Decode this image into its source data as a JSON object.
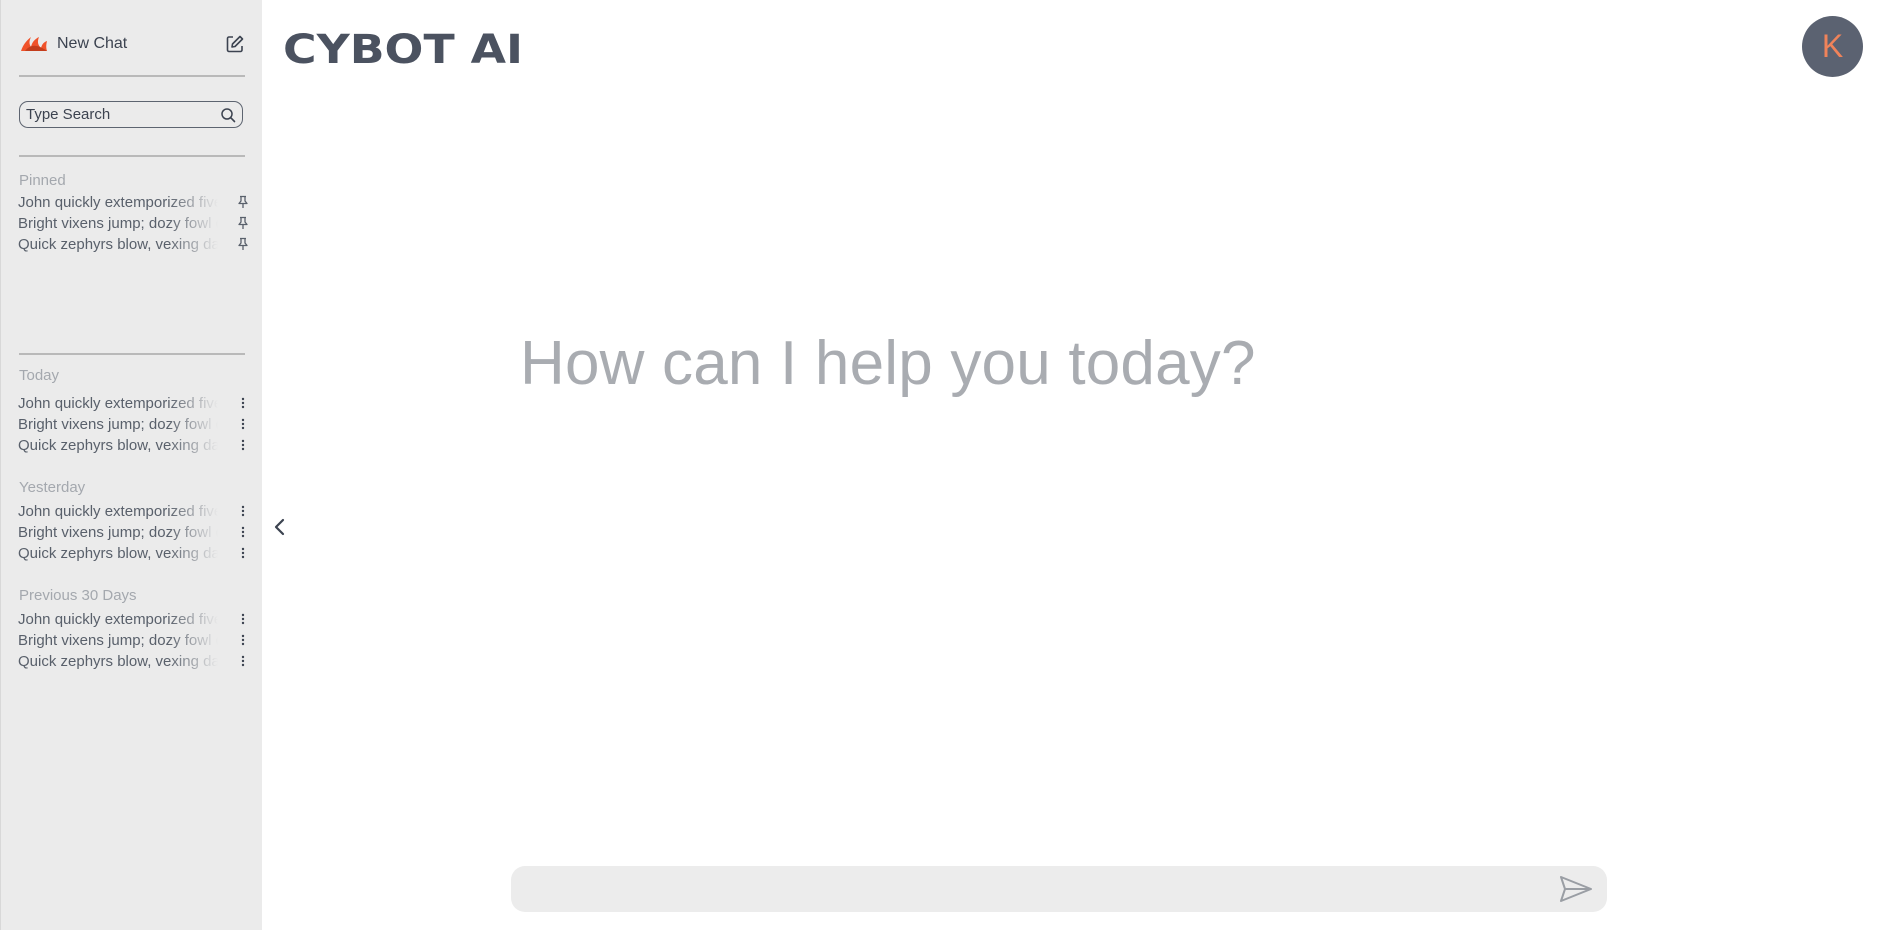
{
  "sidebar": {
    "new_chat_label": "New Chat",
    "search": {
      "placeholder": "Type Search",
      "value": ""
    },
    "pinned": {
      "label": "Pinned",
      "items": [
        "John quickly extemporized five tow bags",
        "Bright vixens jump; dozy fowl quack",
        "Quick zephyrs blow, vexing daft Jim"
      ]
    },
    "groups": [
      {
        "label": "Today",
        "items": [
          "John quickly extemporized five tow bags",
          "Bright vixens jump; dozy fowl quack",
          "Quick zephyrs blow, vexing daft Jim"
        ]
      },
      {
        "label": "Yesterday",
        "items": [
          "John quickly extemporized five tow bags",
          "Bright vixens jump; dozy fowl quack",
          "Quick zephyrs blow, vexing daft Jim"
        ]
      },
      {
        "label": "Previous 30 Days",
        "items": [
          "John quickly extemporized five tow bags",
          "Bright vixens jump; dozy fowl quack",
          "Quick zephyrs blow, vexing daft Jim"
        ]
      }
    ]
  },
  "header": {
    "logo_text": "CYBOT AI"
  },
  "user": {
    "avatar_initial": "K"
  },
  "main": {
    "headline": "How can I help you today?"
  },
  "composer": {
    "placeholder": "",
    "value": ""
  },
  "icons": {
    "brand": "flame-logo-icon",
    "new_chat": "edit-icon",
    "search": "search-icon",
    "pinned_item": "pin-icon",
    "chat_item": "more-vertical-icon",
    "collapse": "chevron-left-icon",
    "send": "send-icon"
  },
  "colors": {
    "brand_accent": "#f0522a",
    "sidebar_bg": "#ebebeb",
    "avatar_bg": "#5b6271",
    "avatar_text": "#f0835a",
    "logo": "#4b5260",
    "headline": "#a9acb1"
  }
}
